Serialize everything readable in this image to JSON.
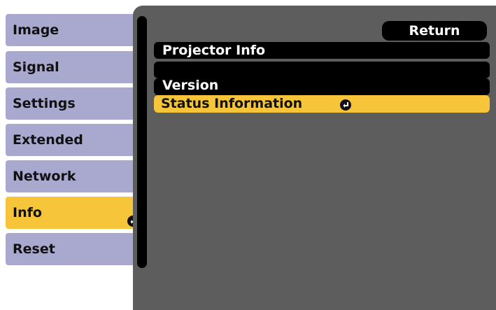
{
  "sidebar": {
    "items": [
      {
        "label": "Image"
      },
      {
        "label": "Signal"
      },
      {
        "label": "Settings"
      },
      {
        "label": "Extended"
      },
      {
        "label": "Network"
      },
      {
        "label": "Info",
        "active": true
      },
      {
        "label": "Reset"
      }
    ]
  },
  "main": {
    "return_label": "Return",
    "rows": [
      {
        "label": "Projector Info"
      },
      {
        "label": "Version"
      },
      {
        "label": "Status Information",
        "selected": true
      }
    ]
  },
  "colors": {
    "menu_item": "#a9a8cf",
    "highlight": "#f7c53a",
    "panel": "#5d5d5d",
    "bar": "#000000"
  },
  "icons": {
    "enter": "enter-return-icon"
  }
}
